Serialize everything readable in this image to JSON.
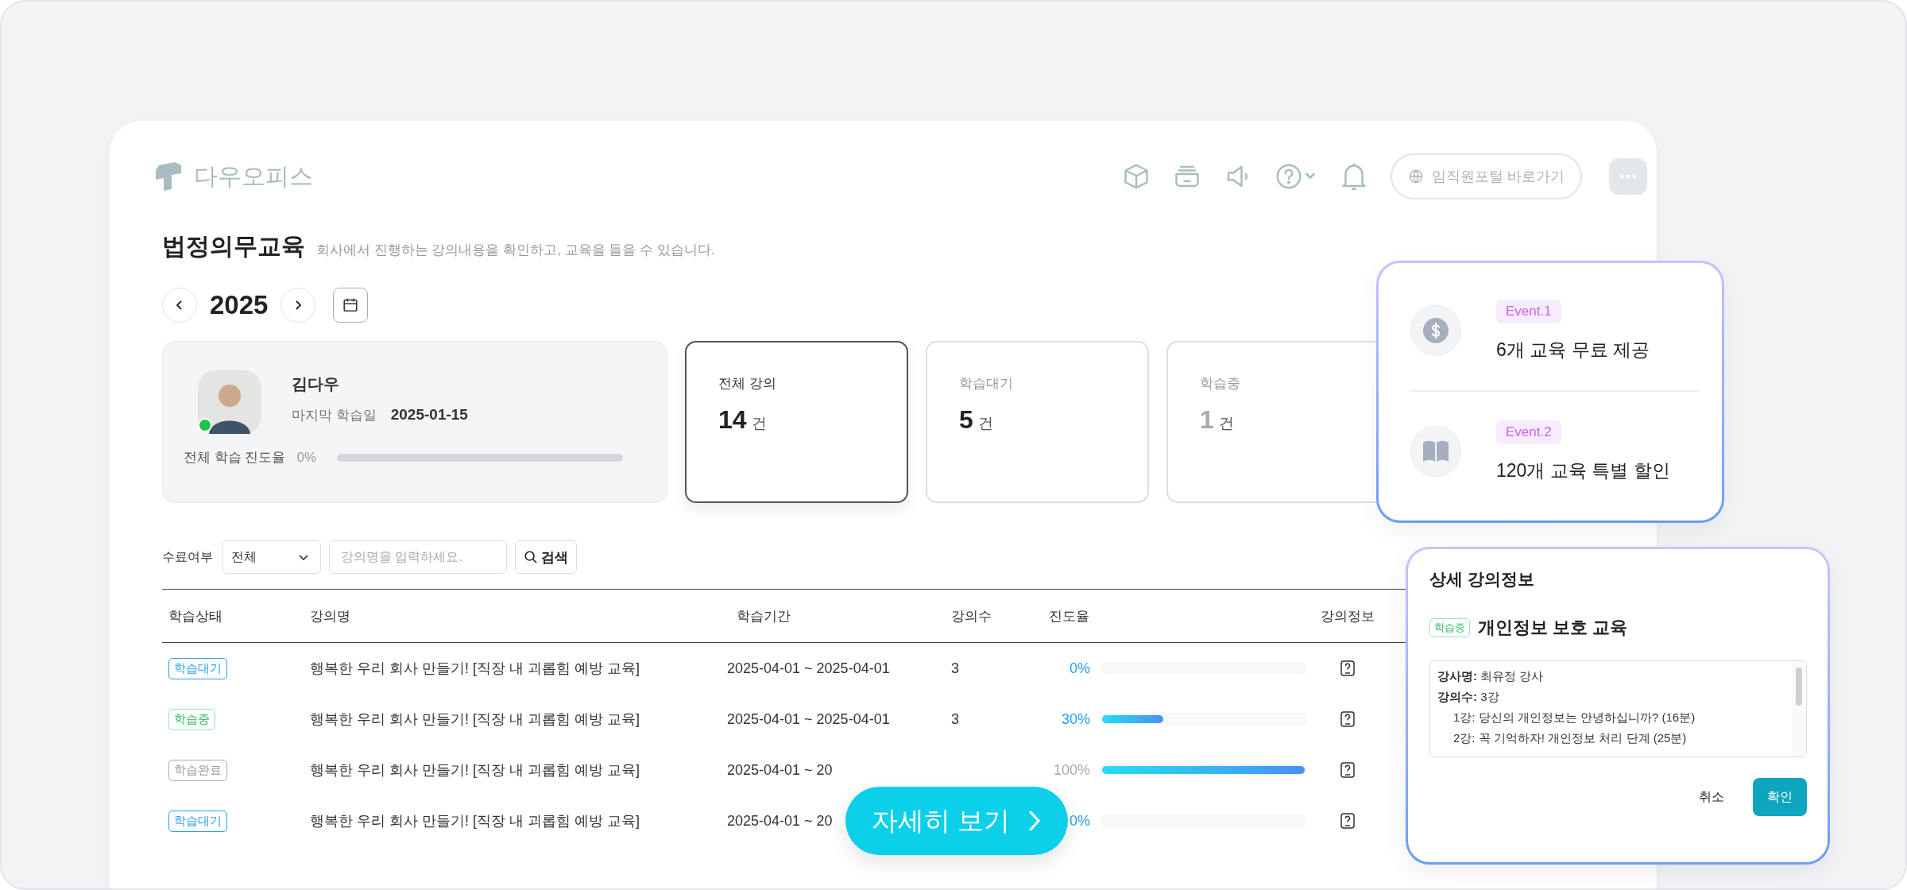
{
  "header": {
    "logo": "다우오피스",
    "portal_link": "임직원포털 바로가기"
  },
  "page": {
    "title": "법정의무교육",
    "subtitle": "회사에서 진행하는 강의내용을 확인하고, 교육을 들을 수 있습니다."
  },
  "year_nav": {
    "year": "2025"
  },
  "profile": {
    "name": "김다우",
    "online": true,
    "last_label": "마지막 학습일",
    "last_date": "2025-01-15",
    "progress_label": "전체 학습 진도율",
    "progress_reading": "0%",
    "level": 0
  },
  "stats": [
    {
      "label": "전체 강의",
      "count": "14",
      "unit": "건",
      "selected": true,
      "dimmed": false
    },
    {
      "label": "학습대기",
      "count": "5",
      "unit": "건",
      "selected": false,
      "dimmed": false
    },
    {
      "label": "학습중",
      "count": "1",
      "unit": "건",
      "selected": false,
      "dimmed": true
    }
  ],
  "filter": {
    "label": "수료여부",
    "select_value": "전체",
    "search_placeholder": "강의명을 입력하세요.",
    "search_button": "검색"
  },
  "table": {
    "columns": [
      "학습상태",
      "강의명",
      "학습기간",
      "강의수",
      "진도율",
      "강의정보"
    ],
    "rows": [
      {
        "status": "학습대기",
        "kind": "waiting",
        "name": "행복한 우리 회사 만들기! [직장 내 괴롭힘 예방 교육]",
        "period": "2025-04-01 ~ 2025-04-01",
        "count": "3",
        "progress": "0%",
        "level": 0
      },
      {
        "status": "학습중",
        "kind": "in_progress",
        "name": "행복한 우리 회사 만들기! [직장 내 괴롭힘 예방 교육]",
        "period": "2025-04-01 ~ 2025-04-01",
        "count": "3",
        "progress": "30%",
        "level": 0.3
      },
      {
        "status": "학습완료",
        "kind": "done",
        "name": "행복한 우리 회사 만들기! [직장 내 괴롭힘 예방 교육]",
        "period": "2025-04-01 ~ 20",
        "progress": "100%",
        "level": 1
      },
      {
        "status": "학습대기",
        "kind": "waiting",
        "name": "행복한 우리 회사 만들기! [직장 내 괴롭힘 예방 교육]",
        "period": "2025-04-01 ~ 20",
        "progress": "0%",
        "level": 0
      }
    ]
  },
  "events": [
    {
      "kind": "dollar",
      "tag": "Event.1",
      "text": "6개 교육 무료 제공"
    },
    {
      "kind": "book",
      "tag": "Event.2",
      "text": "120개 교육 특별 할인"
    }
  ],
  "detail": {
    "title": "상세 강의정보",
    "status": {
      "label": "학습중",
      "kind": "in_progress"
    },
    "course": "개인정보 보호 교육",
    "lines": [
      {
        "kind": "field",
        "text": "**강사명:** 최유정 강사"
      },
      {
        "kind": "field",
        "text": "**강의수:** 3강"
      },
      {
        "kind": "lecture",
        "text": "1강: 당신의 개인정보는 안녕하십니까? (16분)"
      },
      {
        "kind": "lecture",
        "text": "2강: 꼭 기억하자! 개인정보 처리 단계 (25분)"
      }
    ],
    "cancel": "취소",
    "confirm": "확인"
  },
  "cta": {
    "label": "자세히 보기"
  }
}
